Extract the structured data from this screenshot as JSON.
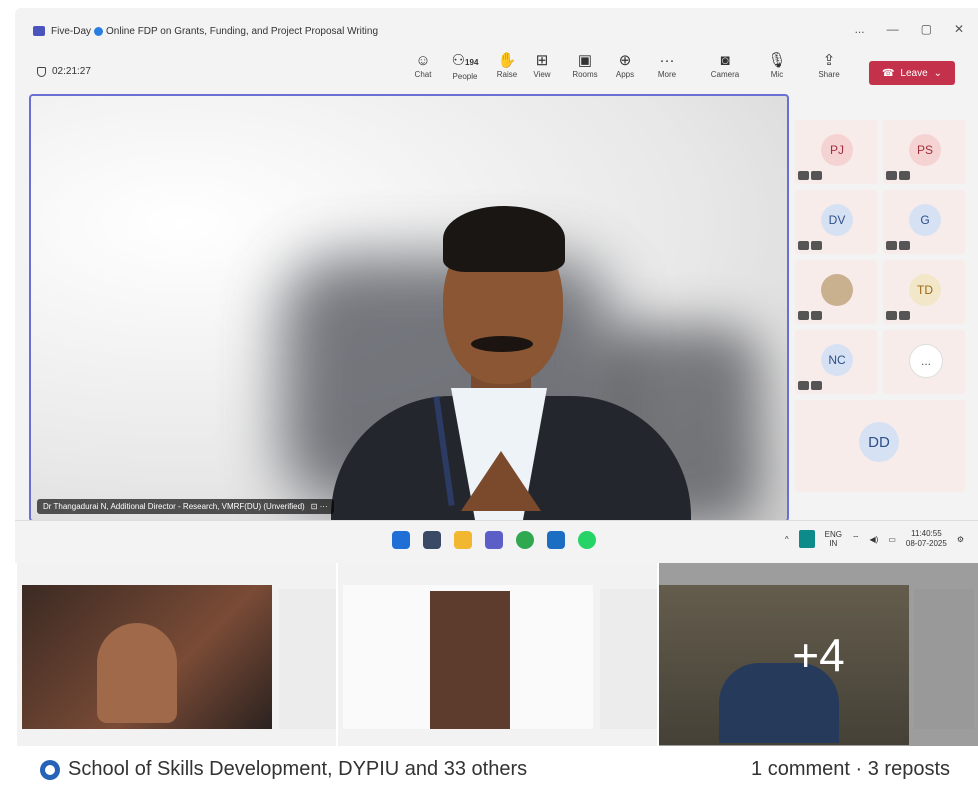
{
  "meeting": {
    "title_prefix": "Five-Day",
    "title_main": "Online FDP on Grants, Funding, and Project Proposal Writing",
    "timer": "02:21:27",
    "window_controls": [
      "...",
      "—",
      "▢",
      "✕"
    ]
  },
  "toolbar": {
    "buttons": [
      {
        "label": "Chat",
        "icon": "chat-icon",
        "glyph": "☺"
      },
      {
        "label": "People",
        "icon": "people-icon",
        "glyph": "⚇",
        "count": "194"
      },
      {
        "label": "Raise",
        "icon": "raise-hand-icon",
        "glyph": "✋"
      },
      {
        "label": "View",
        "icon": "view-icon",
        "glyph": "⊞"
      },
      {
        "label": "Rooms",
        "icon": "rooms-icon",
        "glyph": "▣"
      },
      {
        "label": "Apps",
        "icon": "apps-icon",
        "glyph": "⊕"
      },
      {
        "label": "More",
        "icon": "more-icon",
        "glyph": "···"
      },
      {
        "label": "Camera",
        "icon": "camera-icon",
        "glyph": "◙"
      },
      {
        "label": "Mic",
        "icon": "mic-icon",
        "glyph": "🎙"
      },
      {
        "label": "Share",
        "icon": "share-icon",
        "glyph": "⇪"
      }
    ],
    "leave_label": "Leave",
    "leave_color": "#c4314b"
  },
  "stage": {
    "speaker_caption": "Dr Thangadurai N, Additional Director - Research, VMRF(DU) (Unverified)"
  },
  "participants": [
    {
      "initials": "PJ",
      "color": "#f6d3d3",
      "text": "#a0303a"
    },
    {
      "initials": "PS",
      "color": "#f6d3d3",
      "text": "#a0303a"
    },
    {
      "initials": "DV",
      "color": "#d6e2f3",
      "text": "#2d4f8a"
    },
    {
      "initials": "G",
      "color": "#d6e2f3",
      "text": "#2d4f8a"
    },
    {
      "initials": "",
      "color": "#e7e7e7",
      "text": "#333"
    },
    {
      "initials": "TD",
      "color": "#f3e7c9",
      "text": "#9b6a12"
    },
    {
      "initials": "NC",
      "color": "#d6e2f3",
      "text": "#2d4f8a"
    },
    {
      "initials": "...",
      "color": "#ffffff",
      "text": "#555"
    }
  ],
  "dd_tile": {
    "initials": "DD"
  },
  "tray": {
    "lang": "ENG",
    "region": "IN",
    "time": "11:40:55",
    "date": "08-07-2025"
  },
  "thumbnails": {
    "more_count": "+4"
  },
  "footer": {
    "reactions": "School of Skills Development, DYPIU and 33 others",
    "stats": "1 comment · 3 reposts"
  }
}
